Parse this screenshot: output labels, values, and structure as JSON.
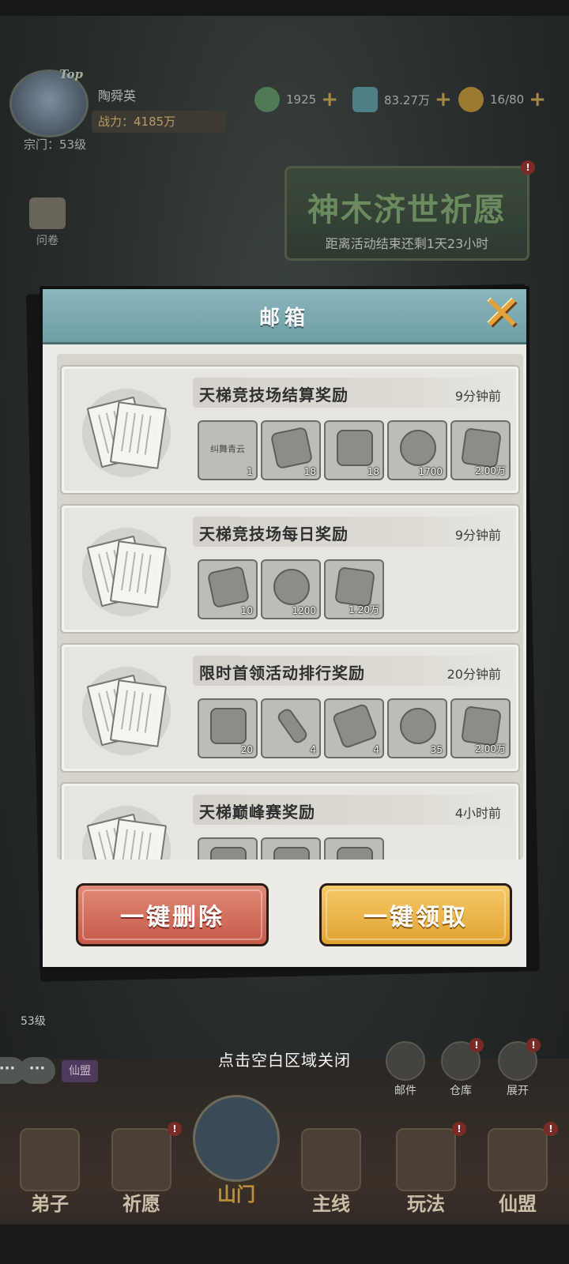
{
  "player": {
    "name": "陶舜英",
    "power": "战力：4185万",
    "sect_level": "宗门：53级",
    "avatar_badge": "Top"
  },
  "resources": [
    {
      "icon": "jade-icon",
      "value": "1925",
      "color": "#4f7a55"
    },
    {
      "icon": "spirit-stone-icon",
      "value": "83.27万",
      "color": "#4f7f86"
    },
    {
      "icon": "stamina-peach-icon",
      "value": "16/80",
      "color": "#9b7a32"
    }
  ],
  "event": {
    "title": "神木济世祈愿",
    "timer": "距离活动结束还剩1天23小时"
  },
  "side_buttons": [
    {
      "label": "问卷"
    }
  ],
  "mail_dialog": {
    "title": "邮箱",
    "items": [
      {
        "title": "天梯竞技场结算奖励",
        "time": "9分钟前",
        "rewards": [
          {
            "icon": "title-plaque-icon",
            "label": "纠舞青云",
            "qty": "1"
          },
          {
            "icon": "ticket-icon",
            "qty": "18"
          },
          {
            "icon": "mystery-chest-icon",
            "qty": "18"
          },
          {
            "icon": "sword-medal-icon",
            "qty": "1700"
          },
          {
            "icon": "spirit-stone-icon",
            "qty": "2.00万"
          }
        ]
      },
      {
        "title": "天梯竞技场每日奖励",
        "time": "9分钟前",
        "rewards": [
          {
            "icon": "ticket-icon",
            "qty": "10"
          },
          {
            "icon": "sword-medal-icon",
            "qty": "1200"
          },
          {
            "icon": "spirit-stone-icon",
            "qty": "1.20万"
          }
        ]
      },
      {
        "title": "限时首领活动排行奖励",
        "time": "20分钟前",
        "rewards": [
          {
            "icon": "treasure-chest-icon",
            "qty": "20"
          },
          {
            "icon": "key-icon",
            "qty": "4"
          },
          {
            "icon": "talisman-icon",
            "qty": "4"
          },
          {
            "icon": "star-coin-icon",
            "qty": "35"
          },
          {
            "icon": "spirit-stone-icon",
            "qty": "2.00万"
          }
        ]
      },
      {
        "title": "天梯巅峰赛奖励",
        "time": "4小时前",
        "rewards": [
          {
            "icon": "reward-icon"
          },
          {
            "icon": "reward-icon"
          },
          {
            "icon": "reward-icon"
          }
        ]
      }
    ],
    "delete_all_label": "一键删除",
    "claim_all_label": "一键领取"
  },
  "close_hint": "点击空白区域关闭",
  "level_tag": "53级",
  "chat": {
    "alliance_label": "仙盟"
  },
  "quick_buttons": [
    {
      "label": "邮件",
      "badge": ""
    },
    {
      "label": "仓库",
      "badge": "!"
    },
    {
      "label": "展开",
      "badge": "!"
    }
  ],
  "nav": [
    {
      "label": "弟子",
      "badge": ""
    },
    {
      "label": "祈愿",
      "badge": "!"
    },
    {
      "label": "山门",
      "badge": ""
    },
    {
      "label": "主线",
      "badge": ""
    },
    {
      "label": "玩法",
      "badge": "!"
    },
    {
      "label": "仙盟",
      "badge": "!"
    }
  ]
}
